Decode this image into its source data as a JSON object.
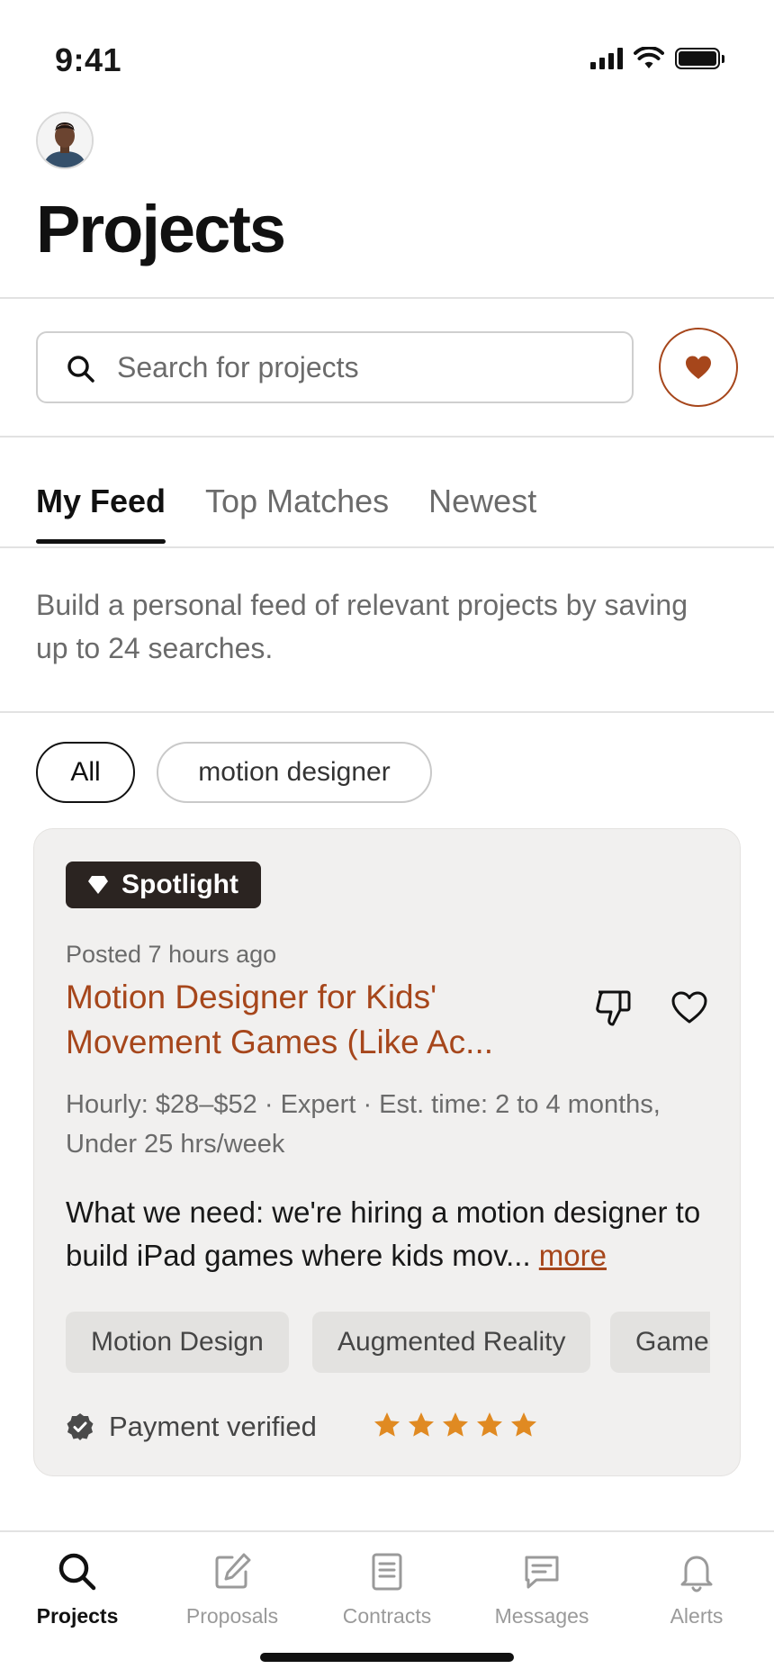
{
  "status_bar": {
    "time": "9:41"
  },
  "header": {
    "title": "Projects"
  },
  "search": {
    "placeholder": "Search for projects"
  },
  "tabs": [
    {
      "label": "My Feed",
      "active": true
    },
    {
      "label": "Top Matches",
      "active": false
    },
    {
      "label": "Newest",
      "active": false
    }
  ],
  "feed_note": "Build a personal feed of relevant projects by saving up to 24 searches.",
  "filters": [
    {
      "label": "All",
      "selected": true
    },
    {
      "label": "motion designer",
      "selected": false
    }
  ],
  "job": {
    "badge": "Spotlight",
    "posted": "Posted 7 hours ago",
    "title": "Motion Designer for Kids' Movement Games (Like Ac...",
    "meta": "Hourly: $28–$52 · Expert · Est. time: 2 to 4 months, Under 25 hrs/week",
    "description": "What we need: we're hiring a motion designer to build iPad games where kids mov...",
    "more_label": "more",
    "skills": [
      "Motion Design",
      "Augmented Reality",
      "Game"
    ],
    "payment_status": "Payment verified",
    "rating": 5
  },
  "bottom_nav": [
    {
      "label": "Projects",
      "icon": "search-icon",
      "active": true
    },
    {
      "label": "Proposals",
      "icon": "edit-icon",
      "active": false
    },
    {
      "label": "Contracts",
      "icon": "document-icon",
      "active": false
    },
    {
      "label": "Messages",
      "icon": "chat-icon",
      "active": false
    },
    {
      "label": "Alerts",
      "icon": "bell-icon",
      "active": false
    }
  ],
  "colors": {
    "accent": "#a6461b",
    "star": "#e08a22",
    "badge_bg": "#2b2421",
    "card_bg": "#f1f0ef"
  }
}
